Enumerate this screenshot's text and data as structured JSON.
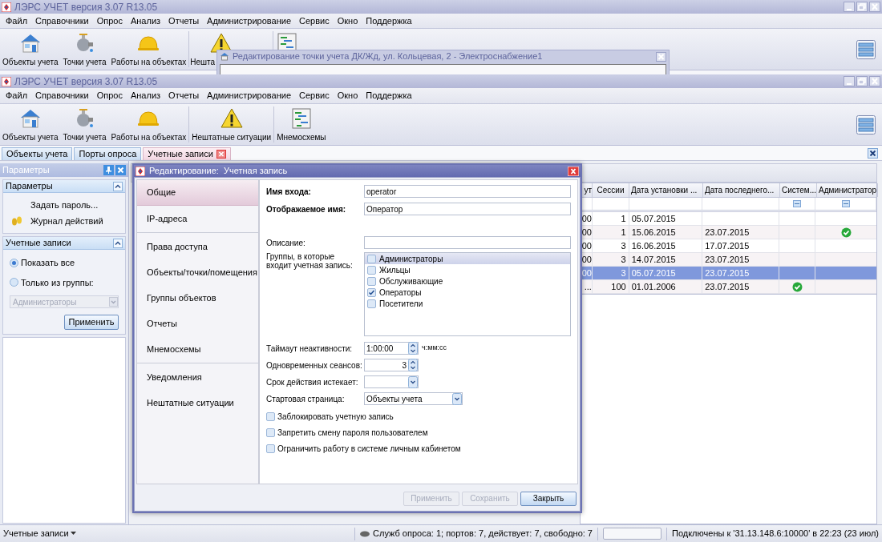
{
  "back_window": {
    "title": "ЛЭРС УЧЕТ версия 3.07 R13.05",
    "menu": [
      "Файл",
      "Справочники",
      "Опрос",
      "Анализ",
      "Отчеты",
      "Администрирование",
      "Сервис",
      "Окно",
      "Поддержка"
    ],
    "toolbar": [
      "Объекты учета",
      "Точки учета",
      "Работы на объектах",
      "Нешта"
    ]
  },
  "floating_window": {
    "title": "Редактирование точки учета ДК/Жд, ул. Кольцевая, 2 - Электроснабжение1"
  },
  "window": {
    "title": "ЛЭРС УЧЕТ версия 3.07 R13.05",
    "menu": [
      "Файл",
      "Справочники",
      "Опрос",
      "Анализ",
      "Отчеты",
      "Администрирование",
      "Сервис",
      "Окно",
      "Поддержка"
    ],
    "toolbar": [
      "Объекты учета",
      "Точки учета",
      "Работы на объектах",
      "Нештатные ситуации",
      "Мнемосхемы"
    ],
    "tabs": [
      {
        "label": "Объекты учета",
        "selected": false,
        "closable": false
      },
      {
        "label": "Порты опроса",
        "selected": false,
        "closable": false
      },
      {
        "label": "Учетные записи",
        "selected": true,
        "closable": true
      }
    ]
  },
  "left_panel": {
    "title": "Параметры",
    "sections": [
      {
        "kind": "links",
        "title": "Параметры",
        "expanded": true,
        "items": [
          "Задать пароль...",
          "Журнал действий"
        ]
      },
      {
        "kind": "filter",
        "title": "Учетные записи",
        "expanded": true,
        "radios": [
          {
            "label": "Показать все",
            "selected": true
          },
          {
            "label": "Только из группы:",
            "selected": false
          }
        ],
        "select": {
          "value": "Администраторы",
          "disabled": true
        },
        "button": "Применить"
      }
    ]
  },
  "table": {
    "columns": [
      "ут",
      "Сессии",
      "Дата установки ...",
      "Дата последнего...",
      "Систем...",
      "Администратор"
    ],
    "rows": [
      {
        "column_1": "00",
        "sessions": "1",
        "installed": "05.07.2015",
        "system": false,
        "admin": false,
        "selected": false
      },
      {
        "column_1": "00",
        "sessions": "1",
        "installed": "15.06.2015",
        "last_login": "23.07.2015",
        "system": false,
        "admin": true,
        "selected": false
      },
      {
        "column_1": "00",
        "sessions": "3",
        "installed": "16.06.2015",
        "last_login": "17.07.2015",
        "system": false,
        "admin": false,
        "selected": false
      },
      {
        "column_1": "00",
        "sessions": "3",
        "installed": "14.07.2015",
        "last_login": "23.07.2015",
        "system": false,
        "admin": false,
        "selected": false
      },
      {
        "column_1": "00",
        "sessions": "3",
        "installed": "05.07.2015",
        "last_login": "23.07.2015",
        "system": false,
        "admin": false,
        "selected": true
      },
      {
        "column_1": "...",
        "sessions": "100",
        "installed": "01.01.2006",
        "last_login": "23.07.2015",
        "system": true,
        "admin": false,
        "selected": false
      }
    ]
  },
  "dialog": {
    "title": "Редактирование:  Учетная запись",
    "nav": [
      {
        "label": "Общие",
        "selected": true
      },
      {
        "label": "IP-адреса",
        "selected": false
      },
      {
        "label": "Права доступа",
        "selected": false
      },
      {
        "label": "Объекты/точки/помещения",
        "selected": false
      },
      {
        "label": "Группы объектов",
        "selected": false
      },
      {
        "label": "Отчеты",
        "selected": false
      },
      {
        "label": "Мнемосхемы",
        "selected": false
      },
      {
        "label": "Уведомления",
        "selected": false
      },
      {
        "label": "Нештатные ситуации",
        "selected": false
      }
    ],
    "fields": [
      {
        "label": "Имя входа:",
        "value": "operator",
        "bold": true
      },
      {
        "label": "Отображаемое имя:",
        "value": "Оператор",
        "bold": true
      }
    ],
    "description": {
      "label": "Описание:"
    },
    "groups_label": "Группы, в которые входит учетная запись:",
    "groups": [
      {
        "label": "Администраторы",
        "checked": false,
        "selected": true
      },
      {
        "label": "Жильцы",
        "checked": false,
        "selected": false
      },
      {
        "label": "Обслуживающие",
        "checked": false,
        "selected": false
      },
      {
        "label": "Операторы",
        "checked": true,
        "selected": false
      },
      {
        "label": "Посетители",
        "checked": false,
        "selected": false
      }
    ],
    "timeout": {
      "label": "Таймаут неактивности:",
      "value": "1:00:00",
      "unit": "ч:мм:сс"
    },
    "sessions": {
      "label": "Одновременных сеансов:",
      "value": "3"
    },
    "expires": {
      "label": "Срок действия истекает:"
    },
    "start_page": {
      "label": "Стартовая страница:",
      "value": "Объекты учета"
    },
    "options": [
      {
        "label": "Заблокировать учетную запись",
        "checked": false
      },
      {
        "label": "Запретить смену пароля пользователем",
        "checked": false
      },
      {
        "label": "Ограничить работу в системе личным кабинетом",
        "checked": false
      }
    ],
    "buttons": [
      {
        "label": "Применить",
        "disabled": true
      },
      {
        "label": "Сохранить",
        "disabled": true
      },
      {
        "label": "Закрыть",
        "disabled": false
      }
    ]
  },
  "status_bar": {
    "view": "Учетные записи",
    "services": "Служб опроса: 1; портов: 7, действует: 7, свободно: 7",
    "connection": "Подключены к '31.13.148.6:10000' в 22:23 (23 июл)"
  }
}
